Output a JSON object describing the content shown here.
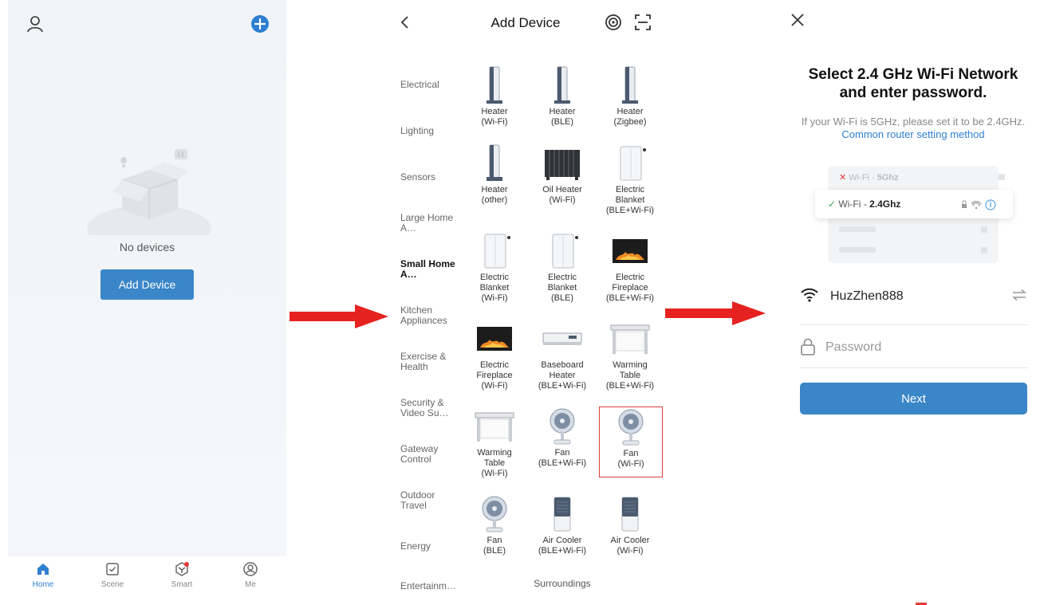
{
  "home": {
    "empty_text": "No devices",
    "add_device_label": "Add Device",
    "nav": [
      {
        "label": "Home",
        "icon": "home-icon"
      },
      {
        "label": "Scene",
        "icon": "scene-icon"
      },
      {
        "label": "Smart",
        "icon": "smart-icon"
      },
      {
        "label": "Me",
        "icon": "me-icon"
      }
    ]
  },
  "add_device": {
    "title": "Add Device",
    "categories": [
      "Electrical",
      "Lighting",
      "Sensors",
      "Large Home A…",
      "Small Home A…",
      "Kitchen Appliances",
      "Exercise & Health",
      "Security & Video Su…",
      "Gateway Control",
      "Outdoor Travel",
      "Energy",
      "Entertainm…"
    ],
    "selected_category": "Small Home A…",
    "devices": [
      {
        "line1": "Heater",
        "line2": "(Wi-Fi)",
        "line3": "",
        "icon": "heater-icon"
      },
      {
        "line1": "Heater",
        "line2": "(BLE)",
        "line3": "",
        "icon": "heater-icon"
      },
      {
        "line1": "Heater",
        "line2": "(Zigbee)",
        "line3": "",
        "icon": "heater-icon"
      },
      {
        "line1": "Heater",
        "line2": "(other)",
        "line3": "",
        "icon": "heater-icon"
      },
      {
        "line1": "Oil Heater",
        "line2": "(Wi-Fi)",
        "line3": "",
        "icon": "oil-heater-icon"
      },
      {
        "line1": "Electric",
        "line2": "Blanket",
        "line3": "(BLE+Wi-Fi)",
        "icon": "electric-blanket-icon"
      },
      {
        "line1": "Electric",
        "line2": "Blanket",
        "line3": "(Wi-Fi)",
        "icon": "electric-blanket-icon"
      },
      {
        "line1": "Electric",
        "line2": "Blanket",
        "line3": "(BLE)",
        "icon": "electric-blanket-icon"
      },
      {
        "line1": "Electric",
        "line2": "Fireplace",
        "line3": "(BLE+Wi-Fi)",
        "icon": "fireplace-icon"
      },
      {
        "line1": "Electric",
        "line2": "Fireplace",
        "line3": "(Wi-Fi)",
        "icon": "fireplace-icon"
      },
      {
        "line1": "Baseboard",
        "line2": "Heater",
        "line3": "(BLE+Wi-Fi)",
        "icon": "baseboard-heater-icon"
      },
      {
        "line1": "Warming",
        "line2": "Table",
        "line3": "(BLE+Wi-Fi)",
        "icon": "warming-table-icon"
      },
      {
        "line1": "Warming",
        "line2": "Table",
        "line3": "(Wi-Fi)",
        "icon": "warming-table-icon"
      },
      {
        "line1": "Fan",
        "line2": "(BLE+Wi-Fi)",
        "line3": "",
        "icon": "fan-icon"
      },
      {
        "line1": "Fan",
        "line2": "(Wi-Fi)",
        "line3": "",
        "icon": "fan-icon"
      },
      {
        "line1": "Fan",
        "line2": "(BLE)",
        "line3": "",
        "icon": "fan-icon"
      },
      {
        "line1": "Air Cooler",
        "line2": "(BLE+Wi-Fi)",
        "line3": "",
        "icon": "air-cooler-icon"
      },
      {
        "line1": "Air Cooler",
        "line2": "(Wi-Fi)",
        "line3": "",
        "icon": "air-cooler-icon"
      }
    ],
    "highlighted_device": "Fan (Wi-Fi)",
    "section_label": "Surroundings"
  },
  "wifi": {
    "title": "Select 2.4 GHz Wi-Fi Network and enter password.",
    "note": "If your Wi-Fi is 5GHz, please set it to be 2.4GHz.",
    "note_link": "Common router setting method",
    "option_5g_prefix": "Wi-Fi - ",
    "option_5g_band": "5Ghz",
    "option_24g_prefix": "Wi-Fi - ",
    "option_24g_band": "2.4Ghz",
    "ssid": "HuzZhen888",
    "password_placeholder": "Password",
    "next_label": "Next"
  },
  "colors": {
    "accent": "#3a86c8",
    "arrow": "#e5221f",
    "highlight": "#d9403a",
    "check": "#3aa757",
    "cross": "#e53935"
  }
}
